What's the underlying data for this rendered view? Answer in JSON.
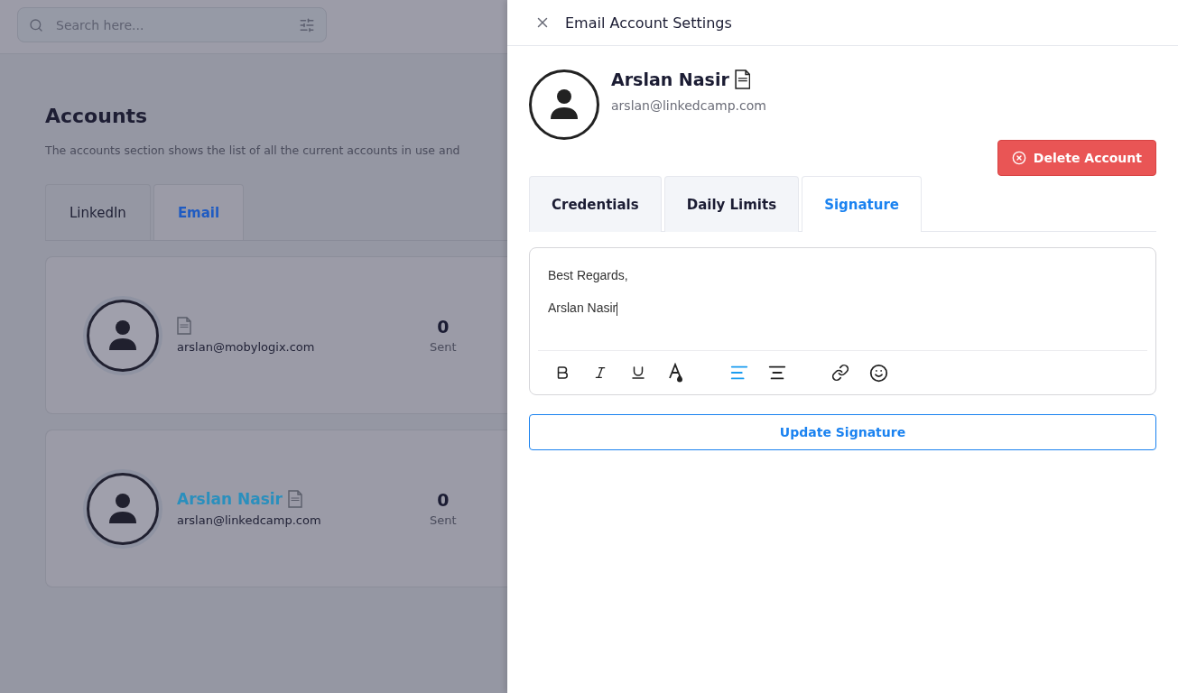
{
  "search": {
    "placeholder": "Search here..."
  },
  "page": {
    "title": "Accounts",
    "description": "The accounts section shows the list of all the current accounts in use and"
  },
  "tabs": [
    {
      "label": "LinkedIn",
      "selected": false
    },
    {
      "label": "Email",
      "selected": true
    }
  ],
  "accounts": [
    {
      "email": "arslan@mobylogix.com",
      "count": "0",
      "count_label": "Sent"
    },
    {
      "name": "Arslan Nasir",
      "email": "arslan@linkedcamp.com",
      "count": "0",
      "count_label": "Sent"
    }
  ],
  "drawer": {
    "title": "Email Account Settings",
    "name": "Arslan Nasir",
    "email": "arslan@linkedcamp.com",
    "delete_button": "Delete Account",
    "tabs": [
      {
        "label": "Credentials",
        "selected": false
      },
      {
        "label": "Daily Limits",
        "selected": false
      },
      {
        "label": "Signature",
        "selected": true
      }
    ],
    "signature_lines": [
      "Best Regards,",
      "Arslan Nasir"
    ],
    "align_buttons": [
      {
        "selected": true
      },
      {
        "selected": false
      }
    ],
    "update_button": "Update Signature"
  }
}
